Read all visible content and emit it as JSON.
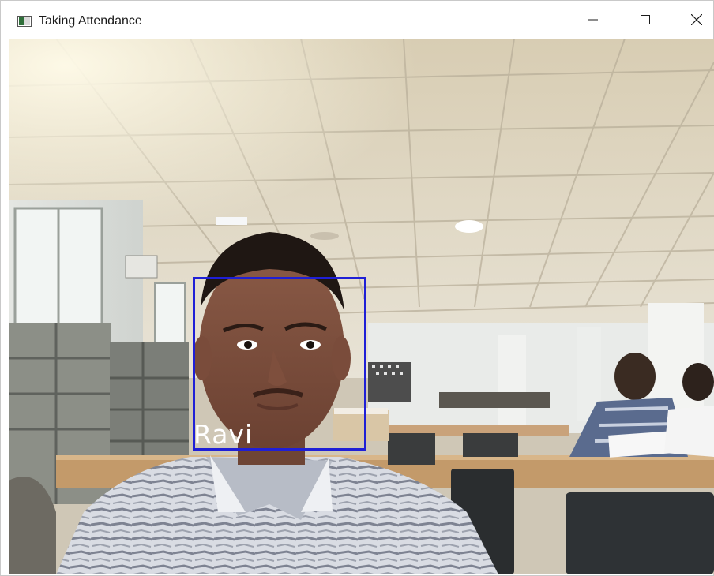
{
  "window": {
    "title": "Taking Attendance",
    "icons": {
      "app": "app-window-icon",
      "minimize": "minimize-icon",
      "maximize": "maximize-icon",
      "close": "close-icon"
    }
  },
  "camera": {
    "detection": {
      "name": "Ravi",
      "box_color": "#1f1fd6",
      "label_color": "#ffffff"
    }
  }
}
